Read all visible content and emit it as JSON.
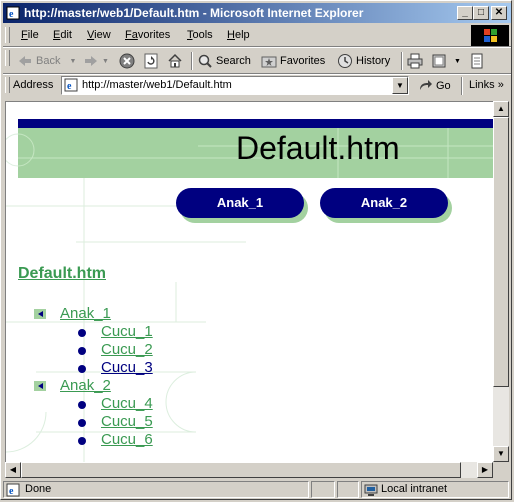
{
  "window": {
    "title": "http://master/web1/Default.htm - Microsoft Internet Explorer",
    "minimize": "_",
    "maximize": "□",
    "close": "✕"
  },
  "menu": {
    "items": [
      {
        "key": "F",
        "rest": "ile"
      },
      {
        "key": "E",
        "rest": "dit"
      },
      {
        "key": "V",
        "rest": "iew"
      },
      {
        "key": "Fa",
        "rest": "vorites"
      },
      {
        "key": "T",
        "rest": "ools"
      },
      {
        "key": "H",
        "rest": "elp"
      }
    ]
  },
  "toolbar": {
    "back": "Back",
    "search": "Search",
    "favorites": "Favorites",
    "history": "History"
  },
  "address": {
    "label": "Address",
    "url": "http://master/web1/Default.htm",
    "go": "Go",
    "links": "Links",
    "links_more": "»"
  },
  "page": {
    "banner_title": "Default.htm",
    "nav_buttons": [
      "Anak_1",
      "Anak_2"
    ],
    "heading": "Default.htm",
    "tree": [
      {
        "label": "Anak_1",
        "children": [
          {
            "label": "Cucu_1",
            "visited": false
          },
          {
            "label": "Cucu_2",
            "visited": false
          },
          {
            "label": "Cucu_3",
            "visited": true
          }
        ]
      },
      {
        "label": "Anak_2",
        "children": [
          {
            "label": "Cucu_4",
            "visited": false
          },
          {
            "label": "Cucu_5",
            "visited": false
          },
          {
            "label": "Cucu_6",
            "visited": false
          }
        ]
      }
    ]
  },
  "status": {
    "text": "Done",
    "zone": "Local intranet"
  },
  "colors": {
    "accent_navy": "#000080",
    "banner_green": "#a3d1a0",
    "link_green": "#3a9a52"
  }
}
